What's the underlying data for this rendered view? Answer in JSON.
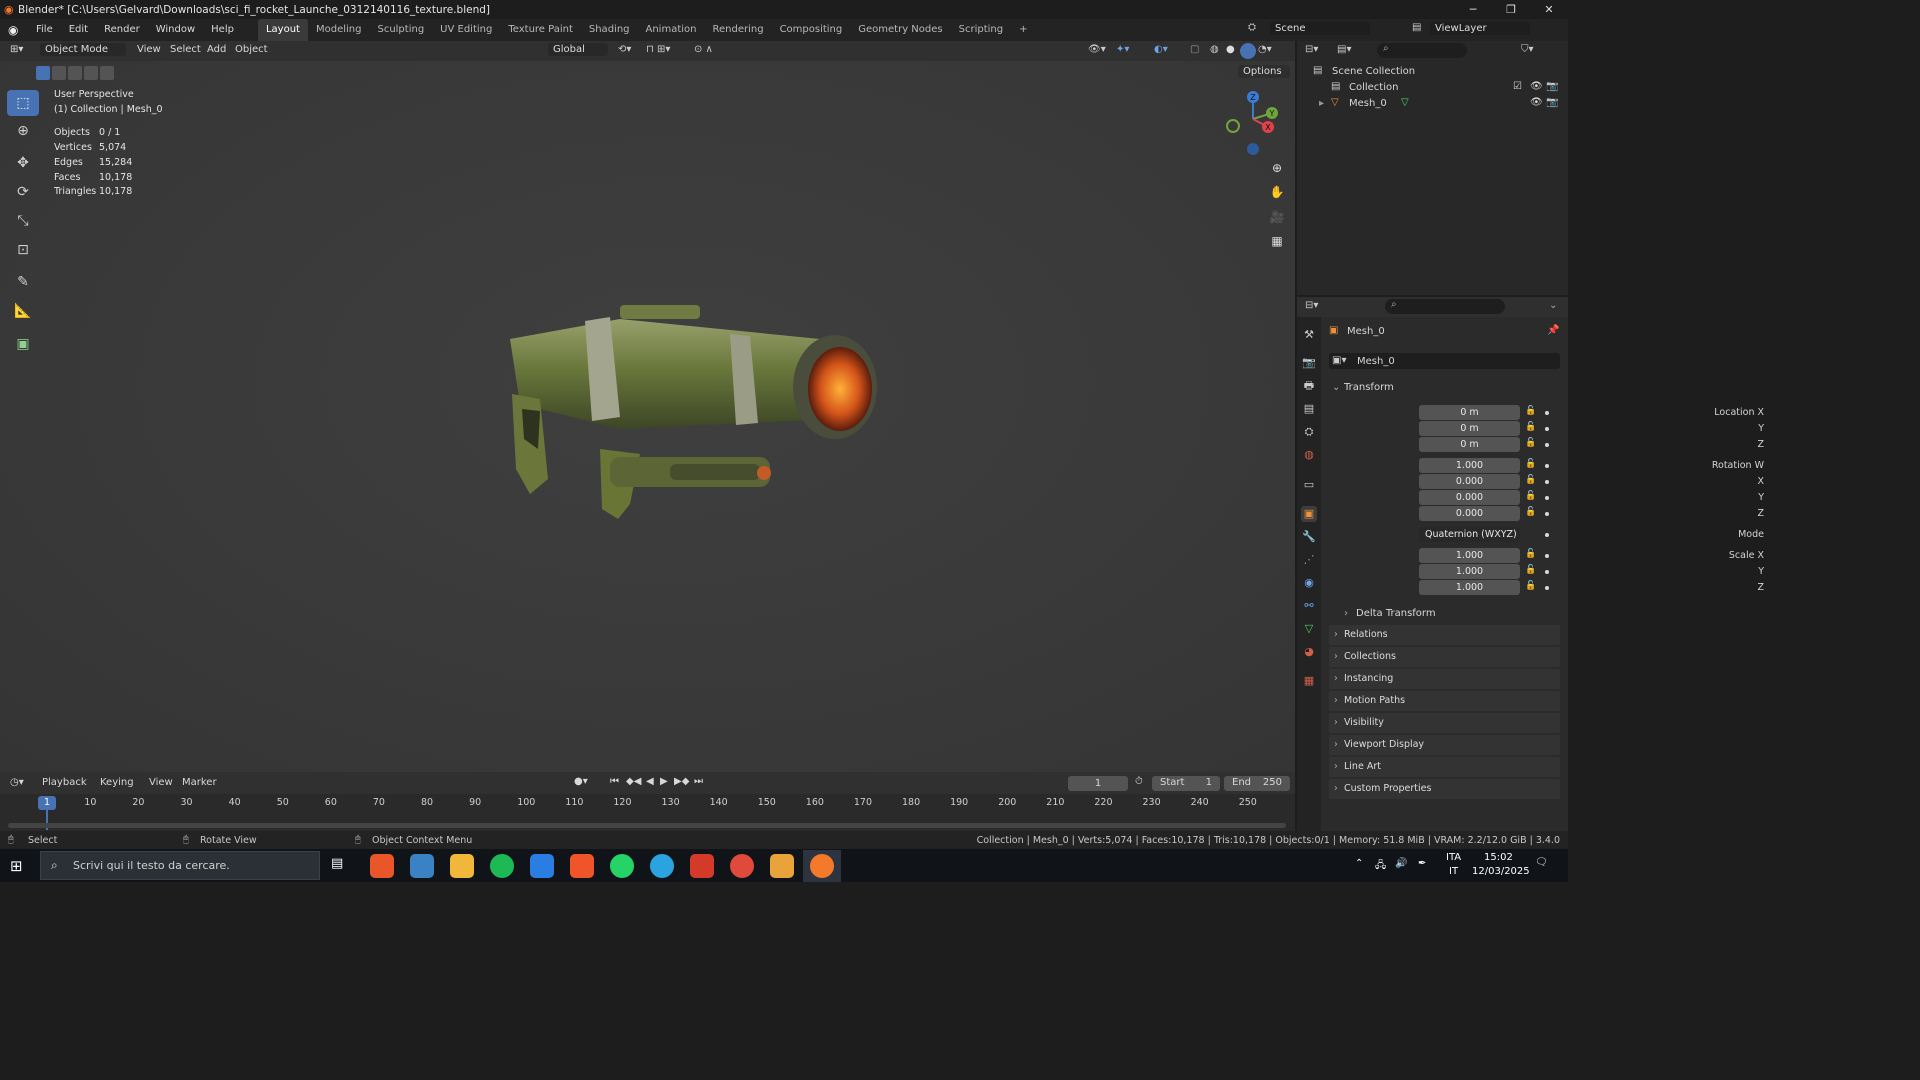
{
  "window": {
    "title": "Blender* [C:\\Users\\Gelvard\\Downloads\\sci_fi_rocket_Launche_0312140116_texture.blend]",
    "minimize": "─",
    "maximize": "❐",
    "close": "✕"
  },
  "menu": [
    "File",
    "Edit",
    "Render",
    "Window",
    "Help"
  ],
  "workspaces": [
    "Layout",
    "Modeling",
    "Sculpting",
    "UV Editing",
    "Texture Paint",
    "Shading",
    "Animation",
    "Rendering",
    "Compositing",
    "Geometry Nodes",
    "Scripting"
  ],
  "active_workspace": "Layout",
  "add_workspace": "+",
  "scene": {
    "name": "Scene",
    "view_layer": "ViewLayer"
  },
  "viewport_header": {
    "mode": "Object Mode",
    "menus": [
      "View",
      "Select",
      "Add",
      "Object"
    ],
    "orientation": "Global",
    "options": "Options"
  },
  "overlay": {
    "perspective": "User Perspective",
    "collection": "(1) Collection | Mesh_0",
    "stats": [
      {
        "label": "Objects",
        "value": "0 / 1"
      },
      {
        "label": "Vertices",
        "value": "5,074"
      },
      {
        "label": "Edges",
        "value": "15,284"
      },
      {
        "label": "Faces",
        "value": "10,178"
      },
      {
        "label": "Triangles",
        "value": "10,178"
      }
    ]
  },
  "gizmo": {
    "z": "Z",
    "y": "Y",
    "x": "X"
  },
  "outliner": {
    "root": "Scene Collection",
    "collection": "Collection",
    "object": "Mesh_0"
  },
  "properties": {
    "object_name": "Mesh_0",
    "datablock": "Mesh_0",
    "transform_title": "Transform",
    "location": {
      "label": "Location X",
      "x": "0 m",
      "y": "0 m",
      "z": "0 m"
    },
    "rotation": {
      "label": "Rotation W",
      "w": "1.000",
      "x": "0.000",
      "y": "0.000",
      "z": "0.000"
    },
    "mode_label": "Mode",
    "mode_value": "Quaternion (WXYZ)",
    "scale": {
      "label": "Scale X",
      "x": "1.000",
      "y": "1.000",
      "z": "1.000"
    },
    "axis_labels": {
      "x": "X",
      "y": "Y",
      "z": "Z"
    },
    "delta": "Delta Transform",
    "panels": [
      "Relations",
      "Collections",
      "Instancing",
      "Motion Paths",
      "Visibility",
      "Viewport Display",
      "Line Art",
      "Custom Properties"
    ]
  },
  "timeline": {
    "menus": [
      "Playback",
      "Keying",
      "View",
      "Marker"
    ],
    "current_frame": "1",
    "start_label": "Start",
    "start": "1",
    "end_label": "End",
    "end": "250",
    "ticks": [
      "1",
      "10",
      "20",
      "30",
      "40",
      "50",
      "60",
      "70",
      "80",
      "90",
      "100",
      "110",
      "120",
      "130",
      "140",
      "150",
      "160",
      "170",
      "180",
      "190",
      "200",
      "210",
      "220",
      "230",
      "240",
      "250"
    ]
  },
  "statusbar": {
    "select": "Select",
    "rotate": "Rotate View",
    "context": "Object Context Menu",
    "info": "Collection | Mesh_0 | Verts:5,074 | Faces:10,178 | Tris:10,178 | Objects:0/1 | Memory: 51.8 MiB | VRAM: 2.2/12.0 GiB | 3.4.0"
  },
  "taskbar": {
    "search": "Scrivi qui il testo da cercare.",
    "lang1": "ITA",
    "lang2": "IT",
    "time": "15:02",
    "date": "12/03/2025"
  },
  "colors": {
    "accent": "#4772b3",
    "axis_x": "#e0414b",
    "axis_y": "#6ea53c",
    "axis_z": "#3a7bd5"
  }
}
